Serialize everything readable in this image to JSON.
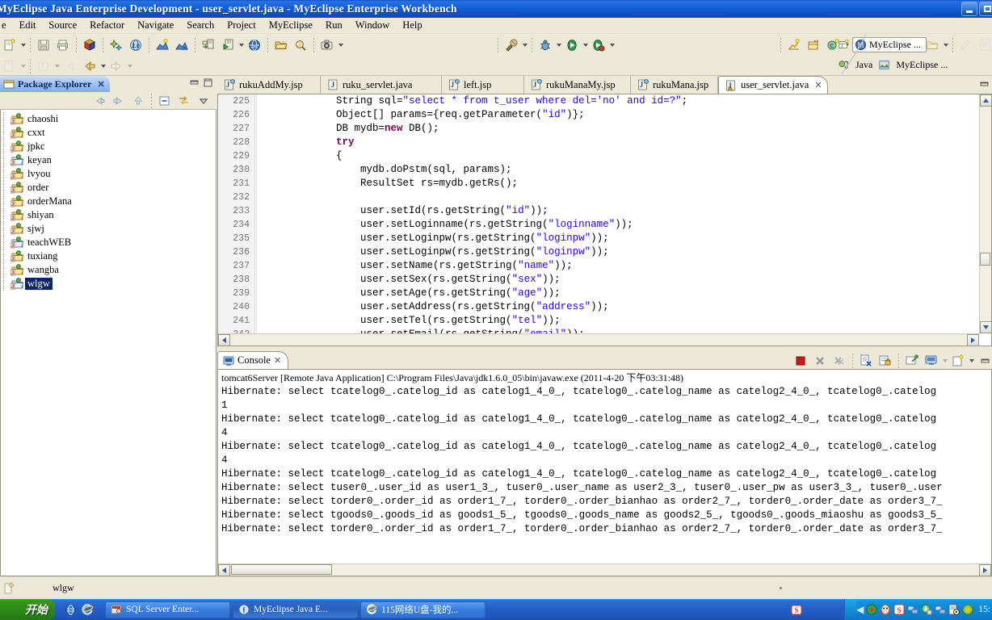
{
  "window": {
    "title": "MyEclipse Java Enterprise Development - user_servlet.java - MyEclipse Enterprise Workbench",
    "minimize_label": "Minimize",
    "maximize_label": "Restore"
  },
  "menubar": {
    "items": [
      {
        "label": "e"
      },
      {
        "label": "Edit"
      },
      {
        "label": "Source"
      },
      {
        "label": "Refactor"
      },
      {
        "label": "Navigate"
      },
      {
        "label": "Search"
      },
      {
        "label": "Project"
      },
      {
        "label": "MyEclipse"
      },
      {
        "label": "Run"
      },
      {
        "label": "Window"
      },
      {
        "label": "Help"
      }
    ]
  },
  "toolbar": {
    "row1": [
      {
        "name": "new-wizard-icon",
        "kind": "new"
      },
      {
        "name": "new-wizard-dropdown-icon",
        "kind": "arrow"
      },
      {
        "name": "sep",
        "kind": "sep"
      },
      {
        "name": "save-icon",
        "kind": "save"
      },
      {
        "name": "print-icon",
        "kind": "print"
      },
      {
        "name": "sep",
        "kind": "sep"
      },
      {
        "name": "build-all-icon",
        "kind": "cube"
      },
      {
        "name": "sep",
        "kind": "sep"
      },
      {
        "name": "new-myeclipse-project-icon",
        "kind": "sparkle"
      },
      {
        "name": "web20-icon",
        "kind": "web20"
      },
      {
        "name": "sep",
        "kind": "sep"
      },
      {
        "name": "deploy-icon",
        "kind": "deploy"
      },
      {
        "name": "undeploy-icon",
        "kind": "undeploy"
      },
      {
        "name": "sep",
        "kind": "sep"
      },
      {
        "name": "run-server-icon",
        "kind": "server"
      },
      {
        "name": "start-server-icon",
        "kind": "serverrun"
      },
      {
        "name": "start-server-dropdown-icon",
        "kind": "arrow"
      },
      {
        "name": "open-browser-icon",
        "kind": "globe"
      },
      {
        "name": "sep",
        "kind": "sep"
      },
      {
        "name": "open-type-icon",
        "kind": "openfolder"
      },
      {
        "name": "search-icon",
        "kind": "searchglass"
      },
      {
        "name": "sep",
        "kind": "sep"
      },
      {
        "name": "snapshot-icon",
        "kind": "camera"
      },
      {
        "name": "snapshot-dropdown-icon",
        "kind": "arrow"
      }
    ],
    "row1b": [
      {
        "name": "sep",
        "kind": "sep"
      },
      {
        "name": "external-tools-icon",
        "kind": "exttool"
      },
      {
        "name": "external-tools-dropdown-icon",
        "kind": "arrow"
      },
      {
        "name": "sep",
        "kind": "sep"
      },
      {
        "name": "debug-icon",
        "kind": "bug"
      },
      {
        "name": "debug-dropdown-icon",
        "kind": "arrow"
      },
      {
        "name": "run-icon",
        "kind": "runplay"
      },
      {
        "name": "run-dropdown-icon",
        "kind": "arrow"
      },
      {
        "name": "run-last-icon",
        "kind": "runlast"
      },
      {
        "name": "run-last-dropdown-icon",
        "kind": "arrow"
      }
    ],
    "row1c": [
      {
        "name": "sep",
        "kind": "sep"
      },
      {
        "name": "new-java-project-icon",
        "kind": "newjava"
      },
      {
        "name": "new-package-icon",
        "kind": "newpkg"
      },
      {
        "name": "new-class-icon",
        "kind": "newclass"
      },
      {
        "name": "new-class-dropdown-icon",
        "kind": "arrow"
      },
      {
        "name": "sep",
        "kind": "sep"
      },
      {
        "name": "open-resource-icon",
        "kind": "openres"
      },
      {
        "name": "edit-icon",
        "kind": "pencil"
      },
      {
        "name": "open-folder-icon",
        "kind": "openfolder2"
      },
      {
        "name": "sep",
        "kind": "sep"
      },
      {
        "name": "next-annotation-icon",
        "kind": "nextfolder"
      },
      {
        "name": "next-annotation-dropdown-icon",
        "kind": "arrow"
      },
      {
        "name": "sep",
        "kind": "sep"
      },
      {
        "name": "previous-edit-icon",
        "kind": "dimpencil"
      },
      {
        "name": "toggle-mark-occurrences-icon",
        "kind": "dimdoc"
      }
    ],
    "row2": [
      {
        "name": "new-dimmed-icon",
        "kind": "dimnew"
      },
      {
        "name": "new-dimmed-dropdown-icon",
        "kind": "arrowdim"
      },
      {
        "name": "sep",
        "kind": "sep"
      },
      {
        "name": "export-dimmed-icon",
        "kind": "dimexport"
      },
      {
        "name": "export-dimmed-dropdown-icon",
        "kind": "arrowdim"
      },
      {
        "name": "back-history-icon",
        "kind": "dimback"
      },
      {
        "name": "back-icon",
        "kind": "backarrow"
      },
      {
        "name": "back-dropdown-icon",
        "kind": "arrow"
      },
      {
        "name": "forward-icon",
        "kind": "fwdarrow"
      },
      {
        "name": "forward-dropdown-icon",
        "kind": "arrowdim"
      }
    ],
    "perspective": {
      "open_perspective_label": "Open Perspective",
      "current": "MyEclipse ...",
      "others": [
        {
          "label": "Java",
          "icon": "java-perspective-icon"
        },
        {
          "label": "MyEclipse ...",
          "icon": "myeclipse-perspective-icon"
        }
      ]
    }
  },
  "package_explorer": {
    "tab_label": "Package Explorer",
    "close_label": "x",
    "view_buttons": [
      {
        "name": "minimize-view-button",
        "label": "minimize"
      },
      {
        "name": "maximize-view-button",
        "label": "maximize"
      }
    ],
    "toolbar_buttons": [
      {
        "name": "back-icon"
      },
      {
        "name": "forward-icon"
      },
      {
        "name": "up-icon"
      },
      {
        "name": "collapse-all-icon"
      },
      {
        "name": "link-with-editor-icon"
      },
      {
        "name": "view-menu-icon"
      }
    ],
    "items": [
      {
        "label": "chaoshi",
        "selected": false,
        "web": true
      },
      {
        "label": "cxxt",
        "selected": false,
        "web": true
      },
      {
        "label": "jpkc",
        "selected": false,
        "web": true
      },
      {
        "label": "keyan",
        "selected": false,
        "web": false
      },
      {
        "label": "lvyou",
        "selected": false,
        "web": true
      },
      {
        "label": "order",
        "selected": false,
        "web": true
      },
      {
        "label": "orderMana",
        "selected": false,
        "web": true
      },
      {
        "label": "shiyan",
        "selected": false,
        "web": true
      },
      {
        "label": "sjwj",
        "selected": false,
        "web": true
      },
      {
        "label": "teachWEB",
        "selected": false,
        "web": false
      },
      {
        "label": "tuxiang",
        "selected": false,
        "web": true
      },
      {
        "label": "wangba",
        "selected": false,
        "web": true
      },
      {
        "label": "wlgw",
        "selected": true,
        "web": false
      }
    ]
  },
  "editor": {
    "tabs": [
      {
        "label": "rukuAddMy.jsp",
        "icon": "jsp-file-icon",
        "active": false,
        "closeable": false
      },
      {
        "label": "ruku_servlet.java",
        "icon": "java-file-icon",
        "active": false,
        "closeable": false
      },
      {
        "label": "left.jsp",
        "icon": "jsp-file-icon",
        "active": false,
        "closeable": false
      },
      {
        "label": "rukuManaMy.jsp",
        "icon": "jsp-file-icon",
        "active": false,
        "closeable": false
      },
      {
        "label": "rukuMana.jsp",
        "icon": "jsp-file-icon",
        "active": false,
        "closeable": false
      },
      {
        "label": "user_servlet.java",
        "icon": "java-warning-file-icon",
        "active": true,
        "closeable": true,
        "close_label": "✕"
      }
    ],
    "first_line_number": 225,
    "lines": [
      {
        "n": 225,
        "segments": [
          {
            "t": "            String sql=",
            "c": "plain"
          },
          {
            "t": "\"select * from t_user where del='no' and id=?\"",
            "c": "str"
          },
          {
            "t": ";",
            "c": "plain"
          }
        ]
      },
      {
        "n": 226,
        "segments": [
          {
            "t": "            Object[] params={req.getParameter(",
            "c": "plain"
          },
          {
            "t": "\"id\"",
            "c": "str"
          },
          {
            "t": ")};",
            "c": "plain"
          }
        ]
      },
      {
        "n": 227,
        "segments": [
          {
            "t": "            DB mydb=",
            "c": "plain"
          },
          {
            "t": "new",
            "c": "kw"
          },
          {
            "t": " DB();",
            "c": "plain"
          }
        ]
      },
      {
        "n": 228,
        "segments": [
          {
            "t": "            ",
            "c": "plain"
          },
          {
            "t": "try",
            "c": "kw"
          }
        ]
      },
      {
        "n": 229,
        "segments": [
          {
            "t": "            {",
            "c": "plain"
          }
        ]
      },
      {
        "n": 230,
        "segments": [
          {
            "t": "                mydb.doPstm(sql, params);",
            "c": "plain"
          }
        ]
      },
      {
        "n": 231,
        "segments": [
          {
            "t": "                ResultSet rs=mydb.getRs();",
            "c": "plain"
          }
        ]
      },
      {
        "n": 232,
        "segments": [
          {
            "t": "",
            "c": "plain"
          }
        ]
      },
      {
        "n": 233,
        "segments": [
          {
            "t": "                user.setId(rs.getString(",
            "c": "plain"
          },
          {
            "t": "\"id\"",
            "c": "str"
          },
          {
            "t": "));",
            "c": "plain"
          }
        ]
      },
      {
        "n": 234,
        "segments": [
          {
            "t": "                user.setLoginname(rs.getString(",
            "c": "plain"
          },
          {
            "t": "\"loginname\"",
            "c": "str"
          },
          {
            "t": "));",
            "c": "plain"
          }
        ]
      },
      {
        "n": 235,
        "segments": [
          {
            "t": "                user.setLoginpw(rs.getString(",
            "c": "plain"
          },
          {
            "t": "\"loginpw\"",
            "c": "str"
          },
          {
            "t": "));",
            "c": "plain"
          }
        ]
      },
      {
        "n": 236,
        "segments": [
          {
            "t": "                user.setLoginpw(rs.getString(",
            "c": "plain"
          },
          {
            "t": "\"loginpw\"",
            "c": "str"
          },
          {
            "t": "));",
            "c": "plain"
          }
        ]
      },
      {
        "n": 237,
        "segments": [
          {
            "t": "                user.setName(rs.getString(",
            "c": "plain"
          },
          {
            "t": "\"name\"",
            "c": "str"
          },
          {
            "t": "));",
            "c": "plain"
          }
        ]
      },
      {
        "n": 238,
        "segments": [
          {
            "t": "                user.setSex(rs.getString(",
            "c": "plain"
          },
          {
            "t": "\"sex\"",
            "c": "str"
          },
          {
            "t": "));",
            "c": "plain"
          }
        ]
      },
      {
        "n": 239,
        "segments": [
          {
            "t": "                user.setAge(rs.getString(",
            "c": "plain"
          },
          {
            "t": "\"age\"",
            "c": "str"
          },
          {
            "t": "));",
            "c": "plain"
          }
        ]
      },
      {
        "n": 240,
        "segments": [
          {
            "t": "                user.setAddress(rs.getString(",
            "c": "plain"
          },
          {
            "t": "\"address\"",
            "c": "str"
          },
          {
            "t": "));",
            "c": "plain"
          }
        ]
      },
      {
        "n": 241,
        "segments": [
          {
            "t": "                user.setTel(rs.getString(",
            "c": "plain"
          },
          {
            "t": "\"tel\"",
            "c": "str"
          },
          {
            "t": "));",
            "c": "plain"
          }
        ]
      },
      {
        "n": 242,
        "segments": [
          {
            "t": "                user.setEmail(rs.getString(",
            "c": "plain"
          },
          {
            "t": "\"email\"",
            "c": "str"
          },
          {
            "t": "));",
            "c": "plain"
          }
        ]
      }
    ]
  },
  "console": {
    "tab_label": "Console",
    "close_label": "✕",
    "toolbar_buttons": [
      {
        "name": "terminate-button",
        "label": "Terminate"
      },
      {
        "name": "remove-launch-button",
        "label": "Remove Launch"
      },
      {
        "name": "remove-all-terminated-button",
        "label": "Remove All Terminated Launches"
      },
      {
        "name": "clear-console-button",
        "label": "Clear Console"
      },
      {
        "name": "scroll-lock-button",
        "label": "Scroll Lock"
      },
      {
        "name": "pin-console-button",
        "label": "Pin Console"
      },
      {
        "name": "display-selected-console-button",
        "label": "Display Selected Console"
      },
      {
        "name": "open-console-button",
        "label": "Open Console"
      },
      {
        "name": "open-console-dropdown-button",
        "label": "Open Console menu"
      },
      {
        "name": "minimize-console-button",
        "label": "Minimize"
      }
    ],
    "header": "tomcat6Server [Remote Java Application] C:\\Program Files\\Java\\jdk1.6.0_05\\bin\\javaw.exe (2011-4-20 下午03:31:48)",
    "lines": [
      "Hibernate: select tcatelog0_.catelog_id as catelog1_4_0_, tcatelog0_.catelog_name as catelog2_4_0_, tcatelog0_.catelog",
      "1",
      "Hibernate: select tcatelog0_.catelog_id as catelog1_4_0_, tcatelog0_.catelog_name as catelog2_4_0_, tcatelog0_.catelog",
      "4",
      "Hibernate: select tcatelog0_.catelog_id as catelog1_4_0_, tcatelog0_.catelog_name as catelog2_4_0_, tcatelog0_.catelog",
      "4",
      "Hibernate: select tcatelog0_.catelog_id as catelog1_4_0_, tcatelog0_.catelog_name as catelog2_4_0_, tcatelog0_.catelog",
      "Hibernate: select tuser0_.user_id as user1_3_, tuser0_.user_name as user2_3_, tuser0_.user_pw as user3_3_, tuser0_.user",
      "Hibernate: select torder0_.order_id as order1_7_, torder0_.order_bianhao as order2_7_, torder0_.order_date as order3_7_",
      "Hibernate: select tgoods0_.goods_id as goods1_5_, tgoods0_.goods_name as goods2_5_, tgoods0_.goods_miaoshu as goods3_5_",
      "Hibernate: select torder0_.order_id as order1_7_, torder0_.order_bianhao as order2_7_, torder0_.order_date as order3_7_"
    ]
  },
  "statusbar": {
    "icon": "writable-icon",
    "text": "wlgw"
  },
  "taskbar": {
    "start_label": "开始",
    "quick_launch": [
      {
        "name": "show-desktop-icon"
      },
      {
        "name": "internet-explorer-quicklaunch-icon"
      }
    ],
    "tasks": [
      {
        "label": "SQL Server Enter...",
        "icon": "sql-server-icon",
        "active": false
      },
      {
        "label": "MyEclipse Java E...",
        "icon": "myeclipse-taskbar-icon",
        "active": true
      },
      {
        "label": "115网络U盘-我的...",
        "icon": "internet-explorer-icon",
        "active": false
      }
    ],
    "pretray": [
      {
        "name": "sogou-input-icon"
      }
    ],
    "tray": [
      {
        "name": "show-hidden-icons-chevron-icon"
      },
      {
        "name": "antivirus-icon"
      },
      {
        "name": "qq-icon"
      },
      {
        "name": "sogou-tray-icon"
      },
      {
        "name": "network-icon"
      },
      {
        "name": "download-manager-icon"
      },
      {
        "name": "network2-icon"
      },
      {
        "name": "media-icon"
      },
      {
        "name": "update-icon"
      }
    ],
    "clock": "15:"
  },
  "colors": {
    "titlebar_blue": "#1560d8",
    "chrome": "#ece9d8",
    "editor_bg": "#ffffff",
    "string_color": "#2a00ff",
    "keyword_color": "#7f0055",
    "selection_blue": "#0a246a",
    "taskbar_blue": "#245fc6",
    "start_green": "#2f8b18"
  }
}
